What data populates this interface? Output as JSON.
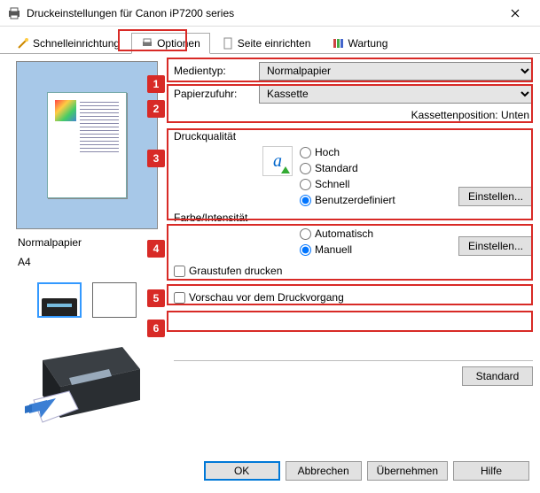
{
  "window": {
    "title": "Druckeinstellungen für Canon iP7200 series"
  },
  "tabs": {
    "quick": "Schnelleinrichtung",
    "options": "Optionen",
    "page": "Seite einrichten",
    "maint": "Wartung"
  },
  "callouts": [
    "1",
    "2",
    "3",
    "4",
    "5",
    "6"
  ],
  "left": {
    "media": "Normalpapier",
    "size": "A4"
  },
  "fields": {
    "mediatype_label": "Medientyp:",
    "mediatype_value": "Normalpapier",
    "source_label": "Papierzufuhr:",
    "source_value": "Kassette",
    "cassette_pos": "Kassettenposition: Unten",
    "quality_label": "Druckqualität",
    "quality": {
      "high": "Hoch",
      "standard": "Standard",
      "fast": "Schnell",
      "custom": "Benutzerdefiniert"
    },
    "set_btn": "Einstellen...",
    "color_label": "Farbe/Intensität",
    "color": {
      "auto": "Automatisch",
      "manual": "Manuell"
    },
    "grayscale": "Graustufen drucken",
    "preview": "Vorschau vor dem Druckvorgang",
    "standard_btn": "Standard"
  },
  "footer": {
    "ok": "OK",
    "cancel": "Abbrechen",
    "apply": "Übernehmen",
    "help": "Hilfe"
  }
}
